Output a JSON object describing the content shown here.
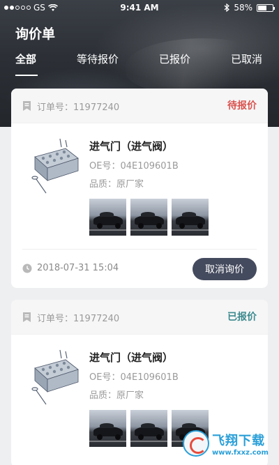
{
  "status_bar": {
    "carrier": "GS",
    "time": "9:41 AM",
    "battery": "58%",
    "battery_level": 0.58
  },
  "header": {
    "title": "询价单",
    "tabs": [
      {
        "label": "全部",
        "active": true
      },
      {
        "label": "等待报价",
        "active": false
      },
      {
        "label": "已报价",
        "active": false
      },
      {
        "label": "已取消",
        "active": false
      }
    ]
  },
  "orders": [
    {
      "order_no": "订单号：11977240",
      "status": "待报价",
      "status_color": "#d9534f",
      "part_name": "进气门（进气阀）",
      "oe": "OE号：04E109601B",
      "quality": "品质：原厂家",
      "photos": 3,
      "time": "2018-07-31 15:04",
      "action": "取消询价"
    },
    {
      "order_no": "订单号：11977240",
      "status": "已报价",
      "status_color": "#3c8a8f",
      "part_name": "进气门（进气阀）",
      "oe": "OE号：04E109601B",
      "quality": "品质：原厂家",
      "photos": 3
    }
  ],
  "watermark": {
    "text": "飞翔下载",
    "url": "www.fxxz.com"
  }
}
